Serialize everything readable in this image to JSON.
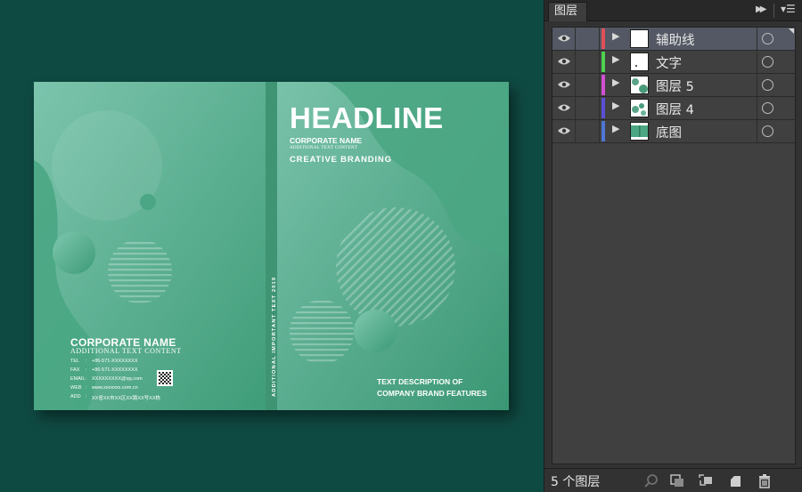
{
  "canvas": {
    "cover": {
      "headline": "HEADLINE",
      "front_company": "CORPORATE NAME",
      "front_additional": "ADDITIONAL TEXT CONTENT",
      "branding": "CREATIVE BRANDING",
      "description_line1": "TEXT DESCRIPTION OF",
      "description_line2": "COMPANY BRAND FEATURES",
      "spine_text": "ADDITIONAL IMPORTANT TEXT 2019",
      "back_company": "CORPORATE NAME",
      "back_additional": "ADDITIONAL TEXT CONTENT",
      "contacts": [
        {
          "label": "TEL",
          "value": "+86-571-XXXXXXXX"
        },
        {
          "label": "FAX",
          "value": "+86-571-XXXXXXXX"
        },
        {
          "label": "EMAIL",
          "value": "XXXXXXXXX@qq.com"
        },
        {
          "label": "WEB",
          "value": "www.xxxxxxx.com.cn"
        },
        {
          "label": "ADD",
          "value": "XX省XX市XX区XX路XX号XX栋"
        }
      ],
      "colors": {
        "background": "#0f4a42",
        "cover_green": "#4aa886",
        "spine": "#3f9474"
      }
    }
  },
  "layers_panel": {
    "tab_title": "图层",
    "layers": [
      {
        "name": "辅助线",
        "color": "#e0505a",
        "selected": true
      },
      {
        "name": "文字",
        "color": "#4fd14f",
        "selected": false
      },
      {
        "name": "图层 5",
        "color": "#d24fd2",
        "selected": false
      },
      {
        "name": "图层 4",
        "color": "#5a4fd6",
        "selected": false
      },
      {
        "name": "底图",
        "color": "#4f76d6",
        "selected": false
      }
    ],
    "footer": {
      "count_label": "5 个图层",
      "icons": [
        "locate-object-icon",
        "make-clipping-mask-icon",
        "create-sublayer-icon",
        "new-layer-icon",
        "delete-layer-icon"
      ]
    }
  }
}
